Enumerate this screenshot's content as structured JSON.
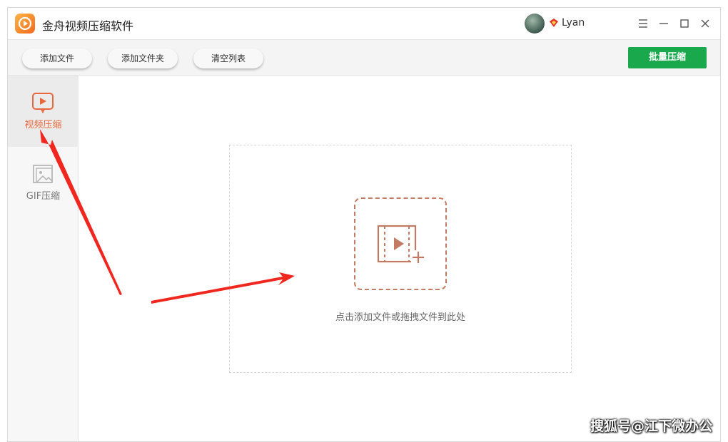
{
  "window": {
    "title": "金舟视频压缩软件",
    "username": "Lyan",
    "controls": [
      "menu-icon",
      "minimize-icon",
      "maximize-icon",
      "close-icon"
    ]
  },
  "toolbar": {
    "add_file": "添加文件",
    "add_folder": "添加文件夹",
    "clear_list": "清空列表",
    "batch_compress": "批量压缩"
  },
  "sidebar": {
    "items": [
      {
        "label": "视频压缩",
        "icon": "video-play-icon",
        "active": true
      },
      {
        "label": "GIF压缩",
        "icon": "image-icon",
        "active": false
      }
    ]
  },
  "dropzone": {
    "hint": "点击添加文件或拖拽文件到此处",
    "icon": "add-video-icon"
  },
  "watermark": "搜狐号@江下微办公",
  "colors": {
    "accent": "#e8683c",
    "primary_button": "#19a84c",
    "drop_icon": "#c27a62",
    "annotation_arrow": "#f0271f"
  }
}
